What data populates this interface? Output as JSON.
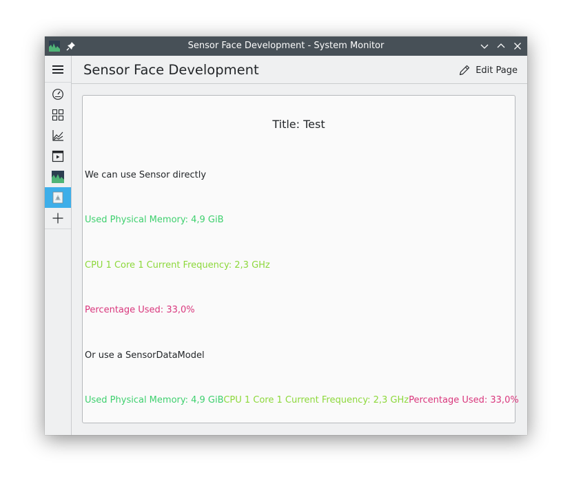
{
  "window": {
    "title": "Sensor Face Development - System Monitor"
  },
  "header": {
    "page_title": "Sensor Face Development",
    "edit_label": "Edit Page"
  },
  "sidebar": {
    "items": [
      {
        "icon": "hamburger-menu-icon"
      },
      {
        "icon": "speedometer-icon"
      },
      {
        "icon": "grid-icon"
      },
      {
        "icon": "line-chart-icon"
      },
      {
        "icon": "application-window-icon"
      },
      {
        "icon": "system-monitor-graph-icon"
      },
      {
        "icon": "document-page-icon",
        "active": true
      },
      {
        "icon": "plus-icon"
      }
    ]
  },
  "face": {
    "title": "Title: Test",
    "intro_direct": "We can use Sensor directly",
    "memory": "Used Physical Memory: 4,9 GiB",
    "cpu": "CPU 1 Core 1 Current Frequency: 2,3 GHz",
    "percent": "Percentage Used: 33,0%",
    "intro_model": "Or use a SensorDataModel",
    "row": {
      "memory": "Used Physical Memory: 4,9 GiB",
      "cpu": "CPU 1 Core 1 Current Frequency: 2,3 GHz",
      "percent": "Percentage Used: 33,0%"
    }
  },
  "colors": {
    "titlebar": "#475057",
    "accent": "#3daee9",
    "memory": "#3ed06e",
    "cpu": "#8cd83a",
    "percent": "#d9367c"
  }
}
